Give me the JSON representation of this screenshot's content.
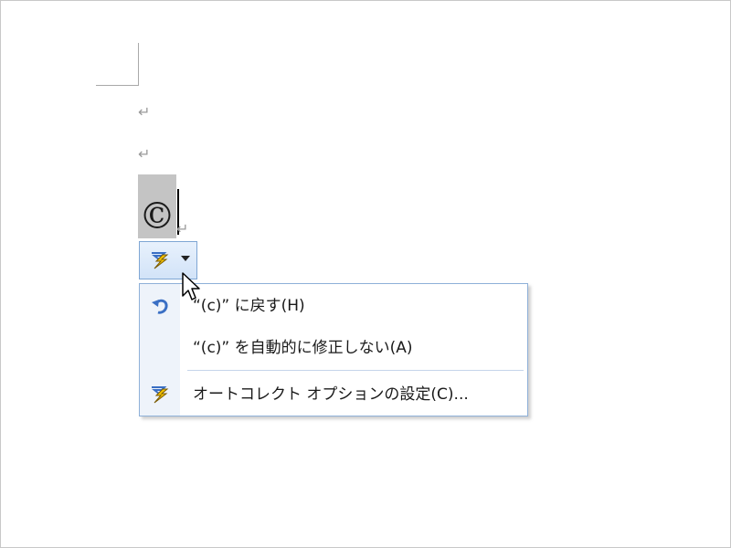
{
  "document": {
    "paragraph_mark": "↵",
    "autocorrected_text": "©"
  },
  "smart_tag": {
    "icon": "autocorrect-lightning-icon",
    "dropdown_icon": "chevron-down-icon"
  },
  "menu": {
    "items": [
      {
        "label": "“(c)” に戻す(H)",
        "icon": "undo-arrow-icon"
      },
      {
        "label": "“(c)” を自動的に修正しない(A)",
        "icon": ""
      },
      {
        "label": "オートコレクト オプションの設定(C)...",
        "icon": "autocorrect-lightning-icon"
      }
    ]
  },
  "colors": {
    "highlight": "#c4c4c4",
    "menu_border": "#8eb0d8",
    "button_border": "#7fa6d4",
    "lightning": "#f5c400",
    "undo": "#3a6fc4"
  }
}
